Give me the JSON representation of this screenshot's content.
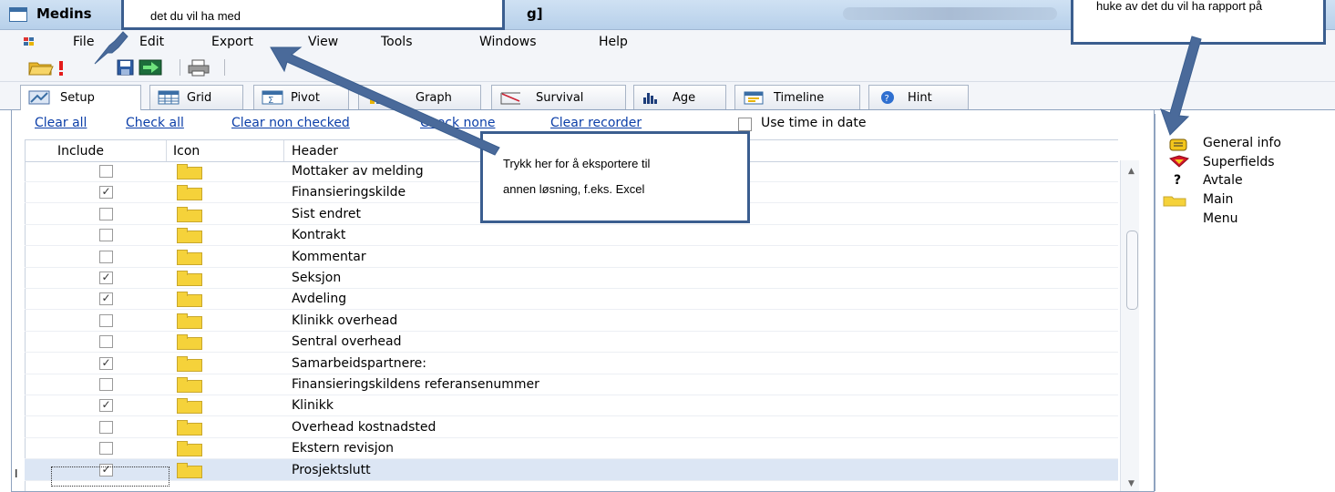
{
  "window": {
    "title_left": "Medins",
    "title_right": "g]"
  },
  "menu": [
    "File",
    "Edit",
    "Export",
    "View",
    "Tools",
    "Windows",
    "Help"
  ],
  "toolbar_icons": [
    "open-folder-icon",
    "alert-icon",
    "save-icon",
    "export-icon",
    "print-icon"
  ],
  "tabs": [
    {
      "label": "Setup",
      "icon": "setup-icon"
    },
    {
      "label": "Grid",
      "icon": "grid-icon"
    },
    {
      "label": "Pivot",
      "icon": "pivot-icon"
    },
    {
      "label": "Graph",
      "icon": "graph-icon"
    },
    {
      "label": "Survival",
      "icon": "survival-icon"
    },
    {
      "label": "Age",
      "icon": "age-icon"
    },
    {
      "label": "Timeline",
      "icon": "timeline-icon"
    },
    {
      "label": "Hint",
      "icon": "hint-icon"
    }
  ],
  "links": [
    "Clear all",
    "Check all",
    "Clear non checked",
    "Check none",
    "Clear recorder"
  ],
  "use_time_label": "Use time in date",
  "columns": {
    "include": "Include",
    "icon": "Icon",
    "header": "Header"
  },
  "rows": [
    {
      "header": "Mottaker av melding",
      "checked": false
    },
    {
      "header": "Finansieringskilde",
      "checked": true
    },
    {
      "header": "Sist endret",
      "checked": false
    },
    {
      "header": "Kontrakt",
      "checked": false
    },
    {
      "header": "Kommentar",
      "checked": false
    },
    {
      "header": "Seksjon",
      "checked": true
    },
    {
      "header": "Avdeling",
      "checked": true
    },
    {
      "header": "Klinikk overhead",
      "checked": false
    },
    {
      "header": "Sentral overhead",
      "checked": false
    },
    {
      "header": "Samarbeidspartnere:",
      "checked": true
    },
    {
      "header": "Finansieringskildens referansenummer",
      "checked": false
    },
    {
      "header": "Klinikk",
      "checked": true
    },
    {
      "header": "Overhead kostnadsted",
      "checked": false
    },
    {
      "header": "Ekstern revisjon",
      "checked": false
    },
    {
      "header": "Prosjektslutt",
      "checked": true
    }
  ],
  "row_indicator": "I",
  "side_panel": [
    "General info",
    "Superfields",
    "Avtale",
    "Main",
    "Menu"
  ],
  "callouts": {
    "top_left": "det du vil ha med",
    "export_line1": "Trykk her for å eksportere til",
    "export_line2": "annen løsning, f.eks. Excel",
    "top_right": "huke av det du vil ha rapport på"
  },
  "colors": {
    "callout_border": "#3b5e8f",
    "arrow": "#4a6a9a",
    "link": "#0b3ea8",
    "selection": "#dce6f4"
  }
}
